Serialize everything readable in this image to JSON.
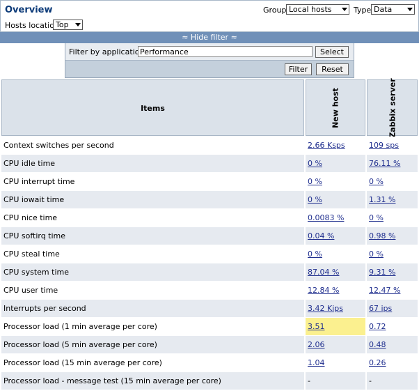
{
  "header": {
    "title": "Overview",
    "group_label": "Group",
    "group_value": "Local hosts",
    "type_label": "Type",
    "type_value": "Data",
    "hosts_location_label": "Hosts location",
    "hosts_location_value": "Top"
  },
  "filter": {
    "toggle_label": "≈ Hide filter ≈",
    "app_label": "Filter by application",
    "app_value": "Performance",
    "select_label": "Select",
    "filter_label": "Filter",
    "reset_label": "Reset"
  },
  "table": {
    "items_header": "Items",
    "hosts": [
      "New host",
      "Zabbix server"
    ],
    "rows": [
      {
        "item": "Context switches per second",
        "values": [
          "2.66 Ksps",
          "109 sps"
        ]
      },
      {
        "item": "CPU idle time",
        "values": [
          "0 %",
          "76.11 %"
        ]
      },
      {
        "item": "CPU interrupt time",
        "values": [
          "0 %",
          "0 %"
        ]
      },
      {
        "item": "CPU iowait time",
        "values": [
          "0 %",
          "1.31 %"
        ]
      },
      {
        "item": "CPU nice time",
        "values": [
          "0.0083 %",
          "0 %"
        ]
      },
      {
        "item": "CPU softirq time",
        "values": [
          "0.04 %",
          "0.98 %"
        ]
      },
      {
        "item": "CPU steal time",
        "values": [
          "0 %",
          "0 %"
        ]
      },
      {
        "item": "CPU system time",
        "values": [
          "87.04 %",
          "9.31 %"
        ]
      },
      {
        "item": "CPU user time",
        "values": [
          "12.84 %",
          "12.47 %"
        ]
      },
      {
        "item": "Interrupts per second",
        "values": [
          "3.42 Kips",
          "67 ips"
        ]
      },
      {
        "item": "Processor load (1 min average per core)",
        "values": [
          "3.51",
          "0.72"
        ]
      },
      {
        "item": "Processor load (5 min average per core)",
        "values": [
          "2.06",
          "0.48"
        ]
      },
      {
        "item": "Processor load (15 min average per core)",
        "values": [
          "1.04",
          "0.26"
        ]
      },
      {
        "item": "Processor load - message test (15 min average per core)",
        "values": [
          "-",
          "-"
        ]
      }
    ]
  },
  "colors": {
    "title": "#0c3a78",
    "filter_bar": "#7090b8",
    "link": "#1f2e8e",
    "highlight": "#fbf08f"
  }
}
